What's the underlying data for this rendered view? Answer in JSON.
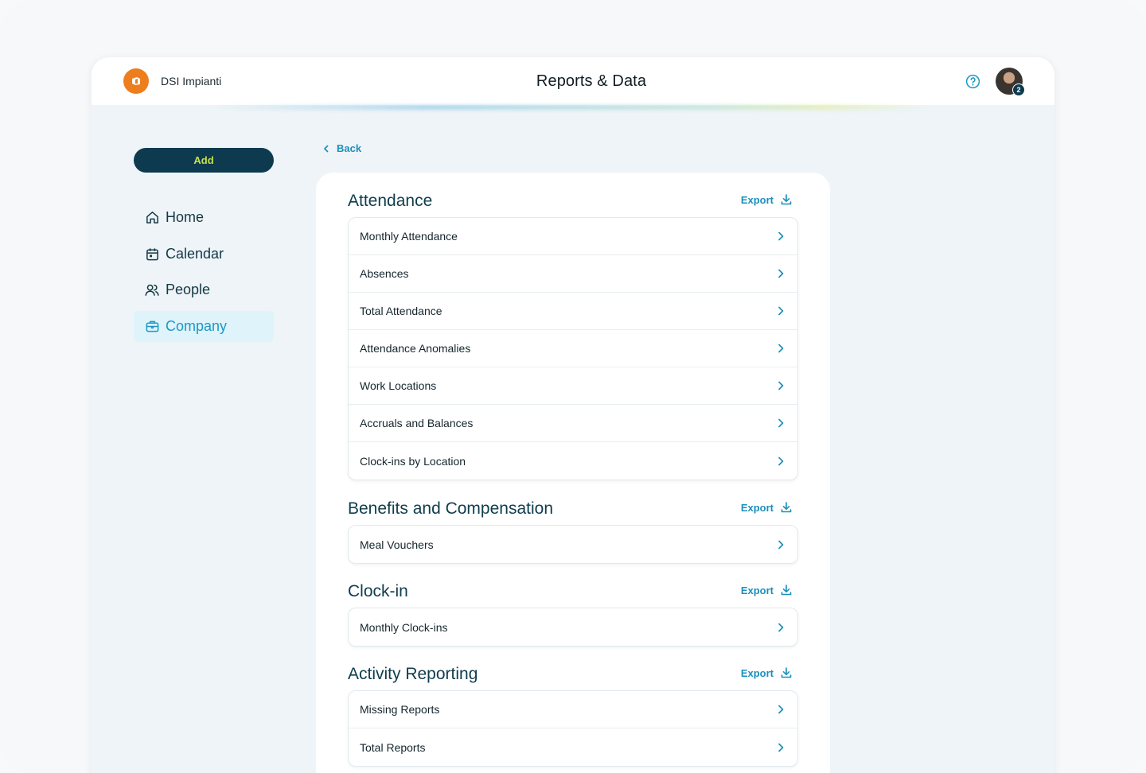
{
  "header": {
    "brand_name": "DSI Impianti",
    "title": "Reports & Data",
    "avatar_badge": "2"
  },
  "sidebar": {
    "add_label": "Add",
    "items": [
      {
        "label": "Home",
        "icon": "home-icon"
      },
      {
        "label": "Calendar",
        "icon": "calendar-icon"
      },
      {
        "label": "People",
        "icon": "people-icon"
      },
      {
        "label": "Company",
        "icon": "briefcase-icon",
        "active": true
      }
    ]
  },
  "back_label": "Back",
  "export_label": "Export",
  "sections": [
    {
      "title": "Attendance",
      "items": [
        "Monthly Attendance",
        "Absences",
        "Total Attendance",
        "Attendance Anomalies",
        "Work Locations",
        "Accruals and Balances",
        "Clock-ins by Location"
      ]
    },
    {
      "title": "Benefits and Compensation",
      "items": [
        "Meal Vouchers"
      ]
    },
    {
      "title": "Clock-in",
      "items": [
        "Monthly Clock-ins"
      ]
    },
    {
      "title": "Activity Reporting",
      "items": [
        "Missing Reports",
        "Total Reports"
      ]
    }
  ],
  "colors": {
    "brand_orange": "#ee7d1d",
    "navy": "#0e3a4f",
    "accent_blue": "#1c8fbb",
    "lime": "#c6e24a",
    "active_bg": "#dff3fb"
  }
}
